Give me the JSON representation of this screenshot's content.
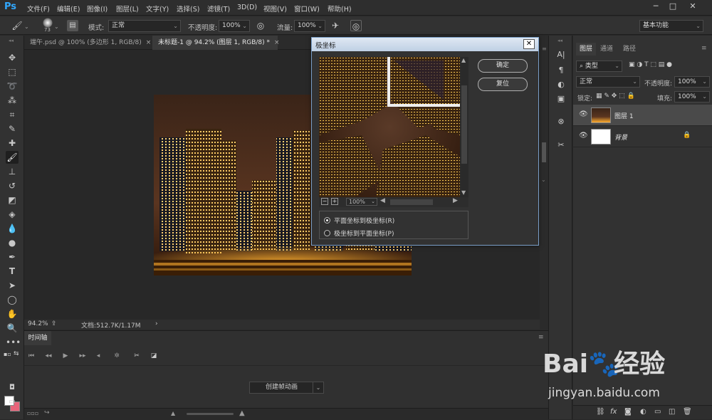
{
  "app": {
    "logo": "Ps",
    "menu": [
      "文件(F)",
      "编辑(E)",
      "图像(I)",
      "图层(L)",
      "文字(Y)",
      "选择(S)",
      "滤镜(T)",
      "3D(D)",
      "视图(V)",
      "窗口(W)",
      "帮助(H)"
    ],
    "window_controls": [
      "─",
      "□",
      "✕"
    ]
  },
  "options": {
    "brush_size": "73",
    "mode_label": "模式:",
    "mode_value": "正常",
    "opacity_label": "不透明度:",
    "opacity_value": "100%",
    "flow_label": "流量:",
    "flow_value": "100%",
    "workspace": "基本功能"
  },
  "tabs": [
    {
      "title": "端午.psd @ 100% (多边形 1, RGB/8)",
      "close": "×"
    },
    {
      "title": "未标题-1 @ 94.2% (图层 1, RGB/8) *",
      "close": "×"
    }
  ],
  "status": {
    "zoom": "94.2%",
    "doc_info": "文档:512.7K/1.17M",
    "arrow": "›"
  },
  "timeline": {
    "tab": "时间轴",
    "create_button": "创建帧动画",
    "dropdown": "⌄"
  },
  "layers_panel": {
    "tabs": [
      "图层",
      "通道",
      "路径"
    ],
    "filter_kind": "类型",
    "blend_mode": "正常",
    "opacity_label": "不透明度:",
    "opacity_value": "100%",
    "lock_label": "锁定:",
    "fill_label": "填充:",
    "fill_value": "100%",
    "layers": [
      {
        "name": "图层 1",
        "selected": true
      },
      {
        "name": "背景",
        "selected": false
      }
    ],
    "footer_icons": [
      "link-icon",
      "fx-icon",
      "mask-icon",
      "adjustment-icon",
      "folder-icon",
      "new-layer-icon",
      "trash-icon"
    ]
  },
  "dialog": {
    "title": "极坐标",
    "close": "✕",
    "ok": "确定",
    "reset": "复位",
    "zoom": "100%",
    "options": [
      {
        "label": "平面坐标到极坐标(R)",
        "selected": true
      },
      {
        "label": "极坐标到平面坐标(P)",
        "selected": false
      }
    ]
  },
  "watermark": {
    "brand_left": "Bai",
    "brand_right": "经验",
    "url": "jingyan.baidu.com"
  },
  "colors": {
    "accent": "#31a8ff",
    "dialog_title_bg": "#c8d8ea"
  }
}
